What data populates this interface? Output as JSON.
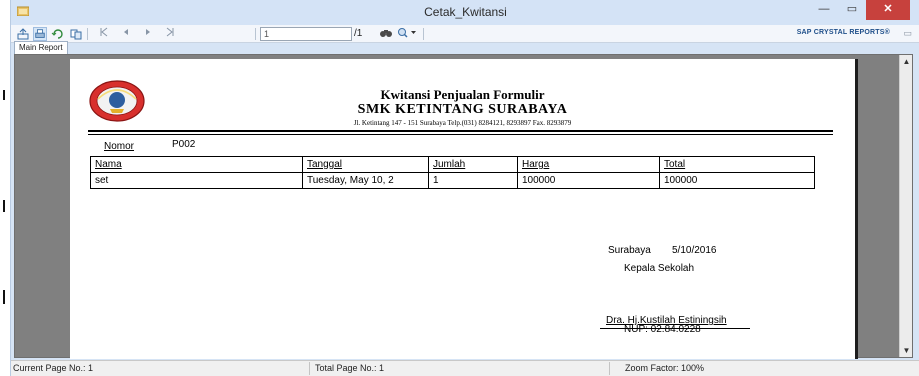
{
  "window": {
    "title": "Cetak_Kwitansi",
    "min_symbol": "—",
    "max_symbol": "▭",
    "close_symbol": "✕"
  },
  "toolbar": {
    "icons": [
      "export-icon",
      "print-icon",
      "refresh-icon",
      "toggle-group-tree-icon",
      "first-page-icon",
      "previous-page-icon",
      "next-page-icon",
      "last-page-icon",
      "find-icon",
      "zoom-icon"
    ],
    "page_input_value": "1",
    "page_of": "/1",
    "brand": "SAP CRYSTAL REPORTS®"
  },
  "tabs": [
    "Main Report"
  ],
  "report": {
    "title": "Kwitansi Penjualan Formulir",
    "school": "SMK KETINTANG SURABAYA",
    "address": "Jl. Ketintang 147 - 151 Surabaya Telp.(031) 8284121, 8293897 Fax. 8293879",
    "nomor_label": "Nomor",
    "nomor_value": "P002",
    "columns": [
      "Nama",
      "Tanggal",
      "Jumlah",
      "Harga",
      "Total"
    ],
    "rows": [
      [
        "set",
        "Tuesday, May 10, 2",
        "1",
        "100000",
        "100000"
      ]
    ],
    "place": "Surabaya",
    "date": "5/10/2016",
    "position": "Kepala Sekolah",
    "signer": "Dra. Hj.Kustilah Estiningsih",
    "nup": "NUP: 02.84.0228"
  },
  "status": {
    "current_page": "Current Page No.: 1",
    "total_page": "Total Page No.: 1",
    "zoom": "Zoom Factor: 100%"
  },
  "colors": {
    "titlebar": "#d4e3f6",
    "close_button": "#c7413d",
    "viewer_background": "#808080",
    "brand": "#1f4f8a"
  }
}
